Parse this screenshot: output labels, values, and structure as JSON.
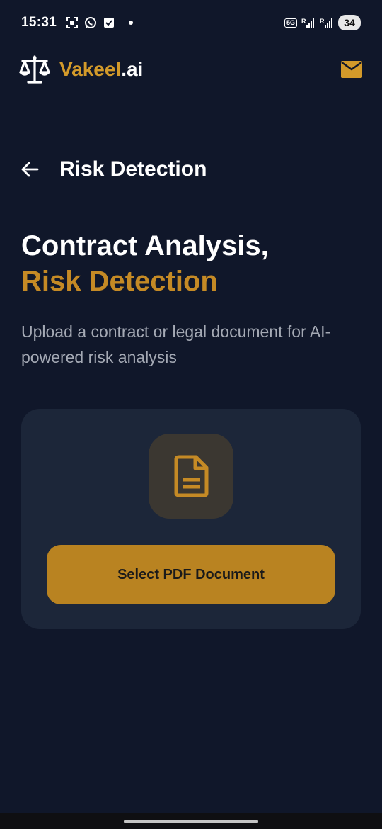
{
  "status_bar": {
    "time": "15:31",
    "network_badge": "5G",
    "signal_1": "R",
    "signal_2": "R",
    "battery": "34"
  },
  "app_header": {
    "brand_accent": "Vakeel",
    "brand_suffix": ".ai",
    "logo_icon": "scales-of-justice-icon",
    "mail_icon": "mail-icon"
  },
  "page_header": {
    "back_icon": "arrow-left-icon",
    "title": "Risk Detection"
  },
  "hero": {
    "line1": "Contract Analysis,",
    "line2": "Risk Detection",
    "description": "Upload a contract or legal document for AI-powered risk analysis"
  },
  "upload_card": {
    "icon": "document-icon",
    "button_label": "Select PDF Document"
  },
  "colors": {
    "background": "#10172a",
    "card": "#1c2639",
    "accent": "#c58a25",
    "button": "#b98321",
    "muted_text": "#a4a9b4"
  }
}
